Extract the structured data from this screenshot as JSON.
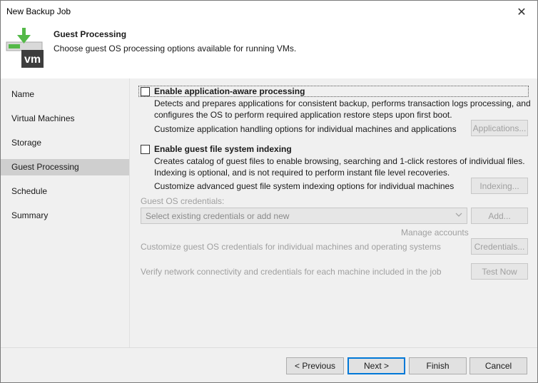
{
  "window": {
    "title": "New Backup Job"
  },
  "header": {
    "title": "Guest Processing",
    "subtitle": "Choose guest OS processing options available for running VMs.",
    "logo_text": "vm"
  },
  "sidebar": {
    "items": [
      {
        "label": "Name",
        "active": false
      },
      {
        "label": "Virtual Machines",
        "active": false
      },
      {
        "label": "Storage",
        "active": false
      },
      {
        "label": "Guest Processing",
        "active": true
      },
      {
        "label": "Schedule",
        "active": false
      },
      {
        "label": "Summary",
        "active": false
      }
    ]
  },
  "app_aware": {
    "label": "Enable application-aware processing",
    "checked": false,
    "desc1": "Detects and prepares applications for consistent backup, performs transaction logs processing, and",
    "desc2": "configures the OS to perform required application restore steps upon first boot.",
    "customize": "Customize application handling options for individual machines and applications",
    "button": "Applications..."
  },
  "indexing": {
    "label": "Enable guest file system indexing",
    "checked": false,
    "desc1": "Creates catalog of guest files to enable browsing, searching and 1-click restores of individual files.",
    "desc2": "Indexing is optional, and is not required to perform instant file level recoveries.",
    "customize": "Customize advanced guest file system indexing options for individual machines",
    "button": "Indexing..."
  },
  "credentials": {
    "label": "Guest OS credentials:",
    "placeholder": "Select existing credentials or add new",
    "add_button": "Add...",
    "manage_link": "Manage accounts",
    "customize": "Customize guest OS credentials for individual machines and operating systems",
    "credentials_button": "Credentials...",
    "verify": "Verify network connectivity and credentials for each machine included in the job",
    "test_button": "Test Now"
  },
  "footer": {
    "previous": "< Previous",
    "next": "Next >",
    "finish": "Finish",
    "cancel": "Cancel"
  },
  "icons": {
    "close": "close-icon",
    "logo": "veeam-vm-backup-icon",
    "dropdown": "chevron-down-icon"
  },
  "colors": {
    "accent_green": "#54b948",
    "logo_dark": "#3d3d3d",
    "focus_blue": "#0078d7"
  }
}
